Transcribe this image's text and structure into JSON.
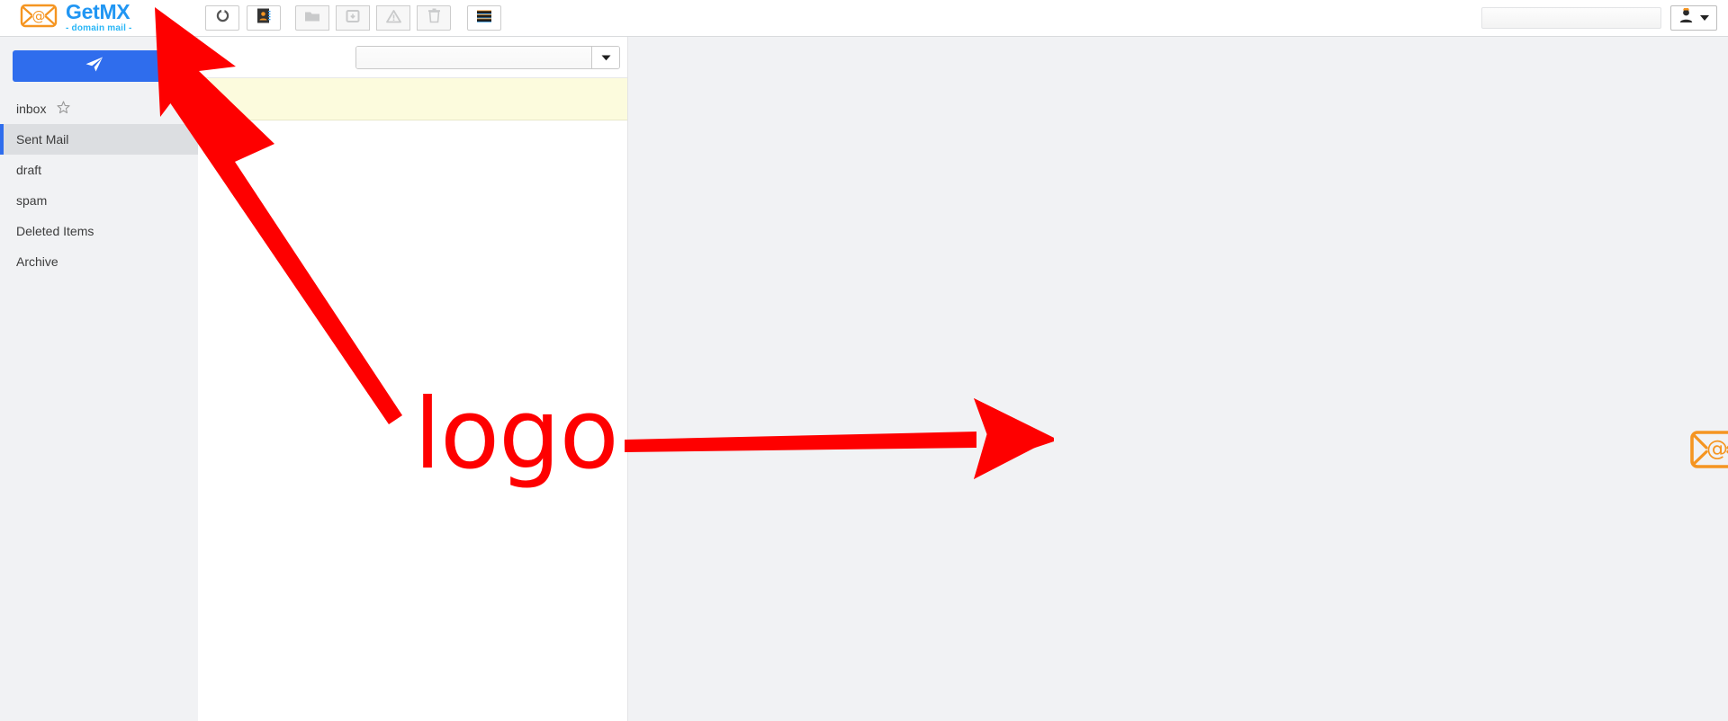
{
  "app": {
    "brand_name": "GetMX",
    "brand_tagline": "- domain mail -"
  },
  "topbar": {
    "toolbar_buttons": [
      {
        "name": "refresh-icon",
        "label": "Refresh",
        "disabled": false
      },
      {
        "name": "contacts-icon",
        "label": "Contacts",
        "disabled": false
      },
      {
        "name": "folder-icon",
        "label": "Move to folder",
        "disabled": true
      },
      {
        "name": "archive-icon",
        "label": "Archive",
        "disabled": true
      },
      {
        "name": "spam-icon",
        "label": "Mark as spam",
        "disabled": true
      },
      {
        "name": "trash-icon",
        "label": "Delete",
        "disabled": true
      },
      {
        "name": "hamburger-icon",
        "label": "More options",
        "disabled": false
      }
    ],
    "search_value": "",
    "search_placeholder": "",
    "account_button_label": ""
  },
  "sidebar": {
    "compose_label": "",
    "items": [
      {
        "label": "inbox",
        "active": false,
        "starred": true
      },
      {
        "label": "Sent Mail",
        "active": true,
        "starred": false
      },
      {
        "label": "draft",
        "active": false,
        "starred": false
      },
      {
        "label": "spam",
        "active": false,
        "starred": false
      },
      {
        "label": "Deleted Items",
        "active": false,
        "starred": false
      },
      {
        "label": "Archive",
        "active": false,
        "starred": false
      }
    ]
  },
  "list_pane": {
    "filter_value": "",
    "filter_placeholder": "",
    "banner_left_text": "",
    "banner_right_text": ""
  },
  "annotations": {
    "label": "logo",
    "color": "#fe0000"
  },
  "colors": {
    "brand_blue": "#2196f3",
    "brand_orange": "#f59521",
    "accent_blue": "#2f6ded",
    "sidebar_bg": "#f1f2f4",
    "selected_bg": "#dcdee1",
    "banner_yellow": "#fcfbdd",
    "annotation_red": "#fe0000"
  }
}
